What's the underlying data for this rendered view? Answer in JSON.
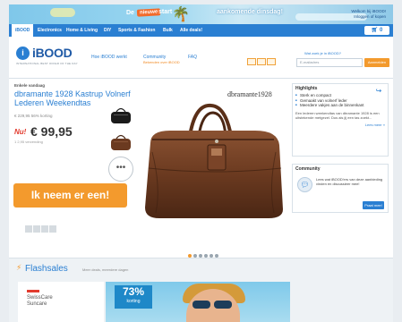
{
  "banner": {
    "de": "De",
    "tag": "nieuwe",
    "start": "start",
    "rest": "aankomende dinsdag!",
    "user_line1": "Welkom bij iBOOD!",
    "user_line2": "Inloggen of kopen"
  },
  "nav": {
    "items": [
      "iBOOD",
      "Electronics",
      "Home & Living",
      "DIY",
      "Sports & Fashion",
      "Bulk",
      "Alle deals!"
    ],
    "cart": "0"
  },
  "header": {
    "logo_word": "iBOOD",
    "logo_tagline": "INTERNATIONAL BEST OFFER OF THE DAY",
    "links": [
      "Hoe iBOOD werkt",
      "Community",
      "FAQ"
    ],
    "community_sub": "Bekenden over iBOOD",
    "search_label": "Wat zoek je in iBOOD?",
    "search_placeholder": "E-mailadres",
    "search_button": "Aanmelden"
  },
  "product": {
    "crumb": "Enkele vandaag",
    "title": "dbramante 1928 Kastrup Volnerf Lederen Weekendtas",
    "old_price": "€ 229,95   56% korting",
    "now_label": "Nu!",
    "price": "€ 99,95",
    "stock": "1 2,95 verzending",
    "cta": "Ik neem er een!",
    "watermark": "dbramante1928",
    "more": "•••",
    "slides": 6,
    "active_slide": 0
  },
  "sidebar": {
    "highlights_title": "Highlights",
    "highlights": [
      "Sterk en compact",
      "Gemaakt van volnerf leder",
      "Meerdere vakjes aan de binnenkant"
    ],
    "highlights_desc": "Een lederen weekendtas van dbramante 1928 is een uitstekende metgezel. Dus als jij een tas zoekt...",
    "highlights_more": "Lees meer »",
    "community_title": "Community",
    "community_text": "Lees wat iBOOD'ers van deze aanbieding vinden en discussieer mee!",
    "community_button": "Praat mee!"
  },
  "flashsales": {
    "title": "Flashsales",
    "subtitle": "Meer deals, meerdere dagen",
    "card_title_1": "SwissCare",
    "card_title_2": "Suncare",
    "badge_pct": "73%",
    "badge_label": "korting"
  },
  "colors": {
    "brand_blue": "#2a7fd2",
    "accent_orange": "#f39a2d",
    "price_red": "#e23b2e"
  }
}
